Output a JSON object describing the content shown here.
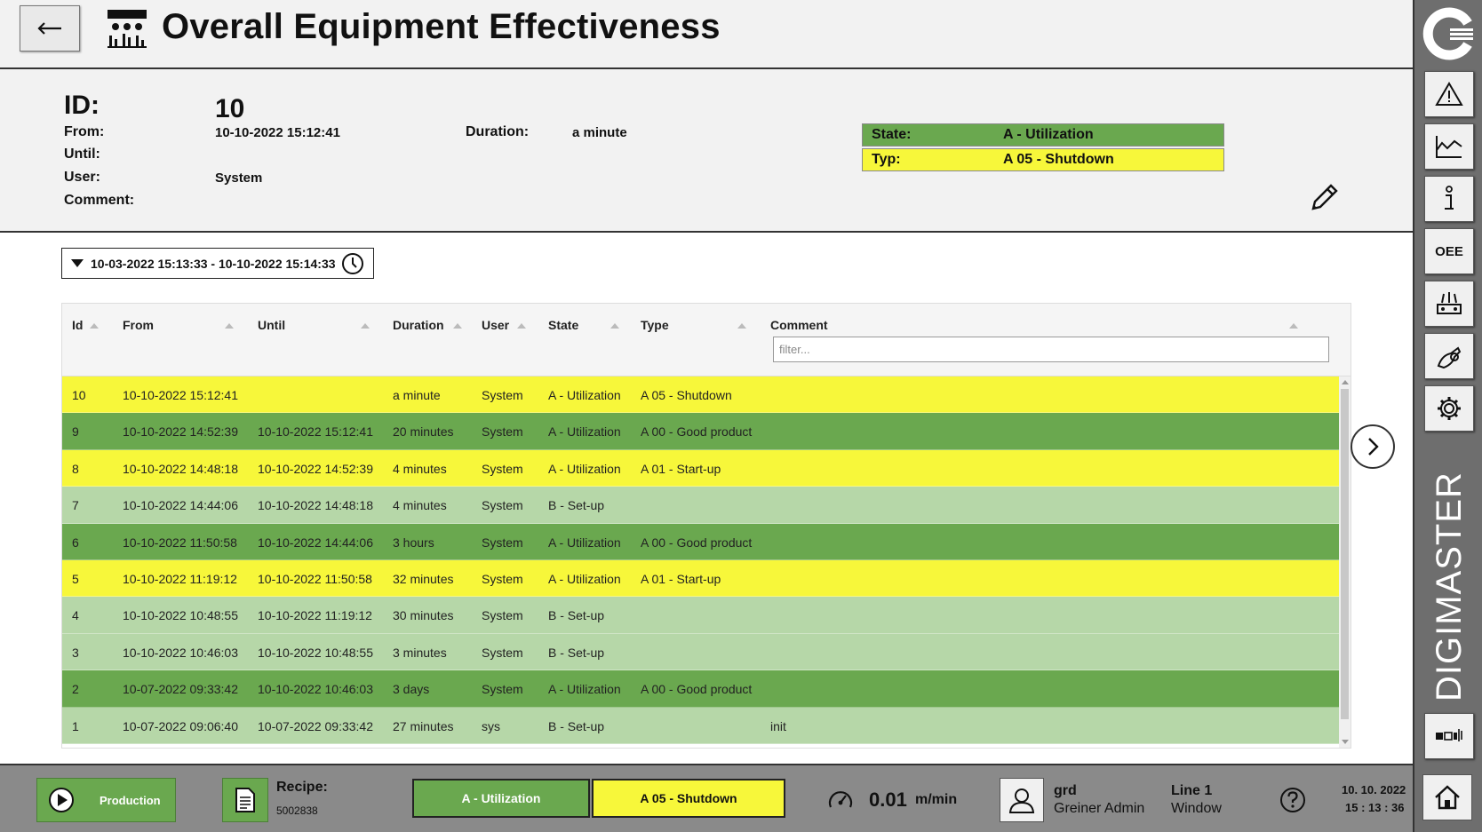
{
  "header": {
    "title": "Overall Equipment Effectiveness",
    "back_icon": "arrow-left-icon",
    "app_icon": "oee-machine-icon"
  },
  "detail": {
    "id_label": "ID:",
    "id_value": "10",
    "from_label": "From:",
    "from_value": "10-10-2022 15:12:41",
    "until_label": "Until:",
    "until_value": "",
    "user_label": "User:",
    "user_value": "System",
    "comment_label": "Comment:",
    "comment_value": "",
    "duration_label": "Duration:",
    "duration_value": "a minute",
    "state_label": "State:",
    "state_value": "A - Utilization",
    "typ_label": "Typ:",
    "typ_value": "A 05 - Shutdown",
    "edit_icon": "pencil-icon"
  },
  "date_range": {
    "value": "10-03-2022 15:13:33 - 10-10-2022 15:14:33",
    "icon": "clock-icon"
  },
  "table": {
    "columns": [
      "Id",
      "From",
      "Until",
      "Duration",
      "User",
      "State",
      "Type",
      "Comment"
    ],
    "filter_placeholder": "filter...",
    "rows": [
      {
        "id": "10",
        "from": "10-10-2022 15:12:41",
        "until": "",
        "duration": "a minute",
        "user": "System",
        "state": "A - Utilization",
        "type": "A 05 - Shutdown",
        "comment": "",
        "color": "#f7f73a"
      },
      {
        "id": "9",
        "from": "10-10-2022 14:52:39",
        "until": "10-10-2022 15:12:41",
        "duration": "20 minutes",
        "user": "System",
        "state": "A - Utilization",
        "type": "A 00 - Good product",
        "comment": "",
        "color": "#6aa84f"
      },
      {
        "id": "8",
        "from": "10-10-2022 14:48:18",
        "until": "10-10-2022 14:52:39",
        "duration": "4 minutes",
        "user": "System",
        "state": "A - Utilization",
        "type": "A 01 - Start-up",
        "comment": "",
        "color": "#f7f73a"
      },
      {
        "id": "7",
        "from": "10-10-2022 14:44:06",
        "until": "10-10-2022 14:48:18",
        "duration": "4 minutes",
        "user": "System",
        "state": "B - Set-up",
        "type": "",
        "comment": "",
        "color": "#b6d7a8"
      },
      {
        "id": "6",
        "from": "10-10-2022 11:50:58",
        "until": "10-10-2022 14:44:06",
        "duration": "3 hours",
        "user": "System",
        "state": "A - Utilization",
        "type": "A 00 - Good product",
        "comment": "",
        "color": "#6aa84f"
      },
      {
        "id": "5",
        "from": "10-10-2022 11:19:12",
        "until": "10-10-2022 11:50:58",
        "duration": "32 minutes",
        "user": "System",
        "state": "A - Utilization",
        "type": "A 01 - Start-up",
        "comment": "",
        "color": "#f7f73a"
      },
      {
        "id": "4",
        "from": "10-10-2022 10:48:55",
        "until": "10-10-2022 11:19:12",
        "duration": "30 minutes",
        "user": "System",
        "state": "B - Set-up",
        "type": "",
        "comment": "",
        "color": "#b6d7a8"
      },
      {
        "id": "3",
        "from": "10-10-2022 10:46:03",
        "until": "10-10-2022 10:48:55",
        "duration": "3 minutes",
        "user": "System",
        "state": "B - Set-up",
        "type": "",
        "comment": "",
        "color": "#b6d7a8"
      },
      {
        "id": "2",
        "from": "10-07-2022 09:33:42",
        "until": "10-10-2022 10:46:03",
        "duration": "3 days",
        "user": "System",
        "state": "A - Utilization",
        "type": "A 00 - Good product",
        "comment": "",
        "color": "#6aa84f"
      },
      {
        "id": "1",
        "from": "10-07-2022 09:06:40",
        "until": "10-07-2022 09:33:42",
        "duration": "27 minutes",
        "user": "sys",
        "state": "B - Set-up",
        "type": "",
        "comment": "init",
        "color": "#b6d7a8"
      }
    ]
  },
  "sidebar": {
    "logo": "greiner-logo-icon",
    "brand": "DIGIMASTER",
    "buttons": [
      "warning-icon",
      "chart-icon",
      "info-icon",
      "oee-icon",
      "machine-icon",
      "service-icon",
      "settings-icon",
      "line-overview-icon"
    ],
    "oee_label": "OEE"
  },
  "statusbar": {
    "production_label": "Production",
    "recipe_label": "Recipe:",
    "recipe_value": "5002838",
    "state": "A - Utilization",
    "type": "A 05 - Shutdown",
    "speed_value": "0.01",
    "speed_unit": "m/min",
    "user_name": "grd",
    "user_role": "Greiner Admin",
    "line_name": "Line 1",
    "line_window": "Window",
    "date": "10. 10. 2022",
    "time": "15 : 13 : 36"
  },
  "colors": {
    "utilization_green": "#6aa84f",
    "setup_light_green": "#b6d7a8",
    "shutdown_yellow": "#f7f73a"
  }
}
